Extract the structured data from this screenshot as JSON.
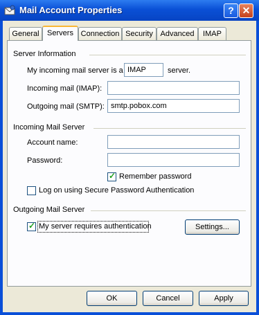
{
  "window": {
    "title": "Mail Account Properties",
    "help_button": "?",
    "close_button": "✕",
    "icon": "mail-account-icon"
  },
  "tabs": [
    {
      "label": "General"
    },
    {
      "label": "Servers"
    },
    {
      "label": "Connection"
    },
    {
      "label": "Security"
    },
    {
      "label": "Advanced"
    },
    {
      "label": "IMAP"
    }
  ],
  "server_info": {
    "heading": "Server Information",
    "incoming_type_prefix": "My incoming mail server is a",
    "incoming_type_value": "IMAP",
    "incoming_type_suffix": "server.",
    "incoming_label": "Incoming mail (IMAP):",
    "incoming_value": "",
    "outgoing_label": "Outgoing mail (SMTP):",
    "outgoing_value": "smtp.pobox.com"
  },
  "incoming_server": {
    "heading": "Incoming Mail Server",
    "account_label": "Account name:",
    "account_value": "",
    "password_label": "Password:",
    "password_value": "",
    "remember_label": "Remember password",
    "remember_checked": true,
    "spa_label": "Log on using Secure Password Authentication",
    "spa_checked": false
  },
  "outgoing_server": {
    "heading": "Outgoing Mail Server",
    "auth_label": "My server requires authentication",
    "auth_checked": true,
    "settings_button": "Settings..."
  },
  "footer": {
    "ok": "OK",
    "cancel": "Cancel",
    "apply": "Apply"
  }
}
